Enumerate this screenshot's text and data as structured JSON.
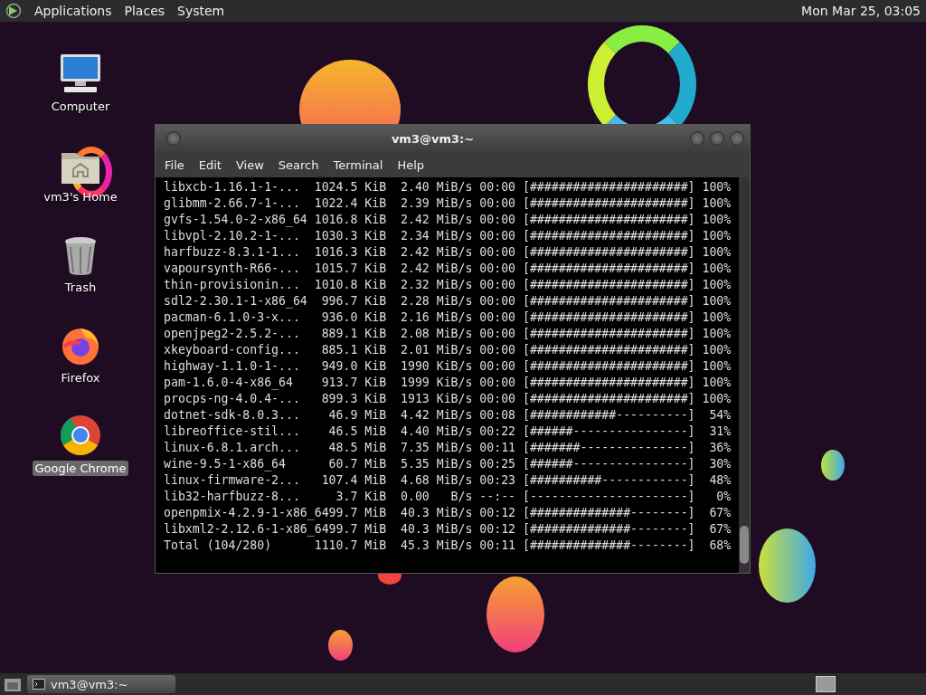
{
  "top_panel": {
    "menus": [
      "Applications",
      "Places",
      "System"
    ],
    "clock": "Mon Mar 25, 03:05"
  },
  "desktop_icons": [
    {
      "label": "Computer",
      "kind": "computer",
      "selected": false
    },
    {
      "label": "vm3's Home",
      "kind": "home",
      "selected": false
    },
    {
      "label": "Trash",
      "kind": "trash",
      "selected": false
    },
    {
      "label": "Firefox",
      "kind": "firefox",
      "selected": false
    },
    {
      "label": "Google Chrome",
      "kind": "chrome",
      "selected": true
    }
  ],
  "terminal": {
    "title": "vm3@vm3:~",
    "menu": [
      "File",
      "Edit",
      "View",
      "Search",
      "Terminal",
      "Help"
    ],
    "lines": [
      "libxcb-1.16.1-1-...  1024.5 KiB  2.40 MiB/s 00:00 [######################] 100%",
      "glibmm-2.66.7-1-...  1022.4 KiB  2.39 MiB/s 00:00 [######################] 100%",
      "gvfs-1.54.0-2-x86_64 1016.8 KiB  2.42 MiB/s 00:00 [######################] 100%",
      "libvpl-2.10.2-1-...  1030.3 KiB  2.34 MiB/s 00:00 [######################] 100%",
      "harfbuzz-8.3.1-1...  1016.3 KiB  2.42 MiB/s 00:00 [######################] 100%",
      "vapoursynth-R66-...  1015.7 KiB  2.42 MiB/s 00:00 [######################] 100%",
      "thin-provisionin...  1010.8 KiB  2.32 MiB/s 00:00 [######################] 100%",
      "sdl2-2.30.1-1-x86_64  996.7 KiB  2.28 MiB/s 00:00 [######################] 100%",
      "pacman-6.1.0-3-x...   936.0 KiB  2.16 MiB/s 00:00 [######################] 100%",
      "openjpeg2-2.5.2-...   889.1 KiB  2.08 MiB/s 00:00 [######################] 100%",
      "xkeyboard-config...   885.1 KiB  2.01 MiB/s 00:00 [######################] 100%",
      "highway-1.1.0-1-...   949.0 KiB  1990 KiB/s 00:00 [######################] 100%",
      "pam-1.6.0-4-x86_64    913.7 KiB  1999 KiB/s 00:00 [######################] 100%",
      "procps-ng-4.0.4-...   899.3 KiB  1913 KiB/s 00:00 [######################] 100%",
      "dotnet-sdk-8.0.3...    46.9 MiB  4.42 MiB/s 00:08 [############----------]  54%",
      "libreoffice-stil...    46.5 MiB  4.40 MiB/s 00:22 [######----------------]  31%",
      "linux-6.8.1.arch...    48.5 MiB  7.35 MiB/s 00:11 [#######---------------]  36%",
      "wine-9.5-1-x86_64      60.7 MiB  5.35 MiB/s 00:25 [######----------------]  30%",
      "linux-firmware-2...   107.4 MiB  4.68 MiB/s 00:23 [##########------------]  48%",
      "lib32-harfbuzz-8...     3.7 KiB  0.00   B/s --:-- [----------------------]   0%",
      "openpmix-4.2.9-1-x86_6499.7 MiB  40.3 MiB/s 00:12 [##############--------]  67%",
      "libxml2-2.12.6-1-x86_6499.7 MiB  40.3 MiB/s 00:12 [##############--------]  67%",
      "Total (104/280)      1110.7 MiB  45.3 MiB/s 00:11 [##############--------]  68%"
    ]
  },
  "taskbar": {
    "tasks": [
      {
        "label": "vm3@vm3:~",
        "selected": true
      }
    ]
  }
}
